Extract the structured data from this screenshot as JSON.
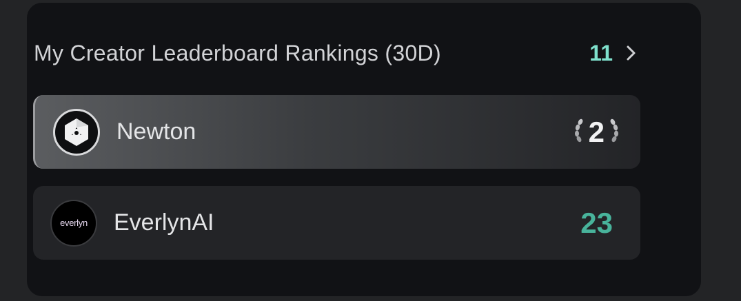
{
  "leaderboard": {
    "title": "My Creator Leaderboard Rankings (30D)",
    "count": "11",
    "rows": [
      {
        "name": "Newton",
        "rank": "2",
        "rank_color": "#f2f2f3",
        "icon": "newton-logo-icon",
        "laurel": true
      },
      {
        "name": "EverlynAI",
        "rank": "23",
        "rank_color": "#48b39b",
        "icon": "everlyn-logo-icon",
        "logo_text": "everlyn",
        "laurel": false
      }
    ]
  },
  "colors": {
    "background": "#232426",
    "panel": "#111215",
    "accent_count": "#7fe0cc",
    "rank_green": "#48b39b"
  }
}
